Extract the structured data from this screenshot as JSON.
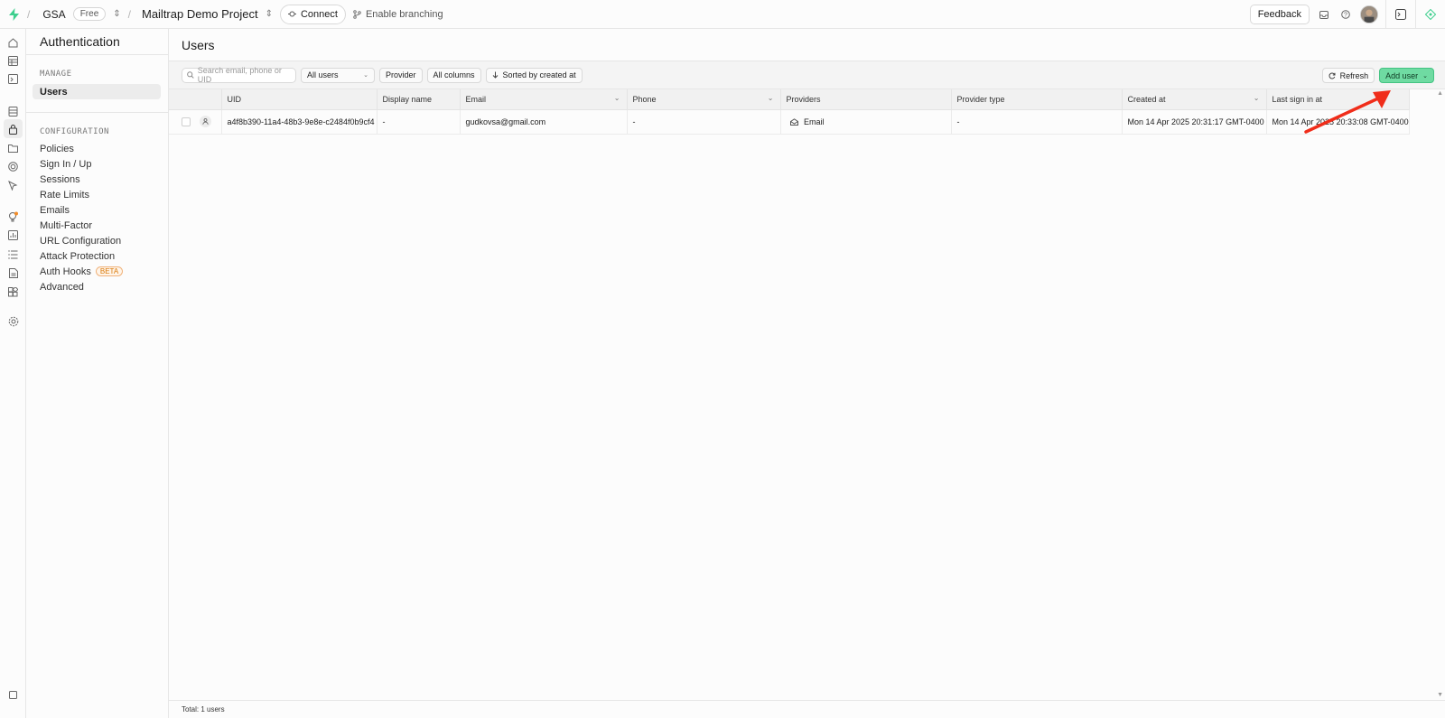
{
  "topbar": {
    "org": "GSA",
    "plan": "Free",
    "project": "Mailtrap Demo Project",
    "connect": "Connect",
    "branching": "Enable branching",
    "feedback": "Feedback"
  },
  "sidenav": {
    "title": "Authentication",
    "manage_label": "MANAGE",
    "manage_items": [
      "Users"
    ],
    "config_label": "CONFIGURATION",
    "config_items": [
      "Policies",
      "Sign In / Up",
      "Sessions",
      "Rate Limits",
      "Emails",
      "Multi-Factor",
      "URL Configuration",
      "Attack Protection",
      "Auth Hooks",
      "Advanced"
    ],
    "beta_badge": "BETA"
  },
  "main": {
    "title": "Users",
    "search_placeholder": "Search email, phone or UID",
    "filter_users": "All users",
    "provider": "Provider",
    "all_columns": "All columns",
    "sorted": "Sorted by created at",
    "refresh": "Refresh",
    "add_user": "Add user",
    "footer": "Total: 1 users"
  },
  "table": {
    "columns": [
      "UID",
      "Display name",
      "Email",
      "Phone",
      "Providers",
      "Provider type",
      "Created at",
      "Last sign in at"
    ],
    "rows": [
      {
        "uid": "a4f8b390-11a4-48b3-9e8e-c2484f0b9cf4",
        "display_name": "-",
        "email": "gudkovsa@gmail.com",
        "phone": "-",
        "providers": "Email",
        "provider_type": "-",
        "created_at": "Mon 14 Apr 2025 20:31:17 GMT-0400",
        "last_sign_in": "Mon 14 Apr 2025 20:33:08 GMT-0400"
      }
    ]
  },
  "colors": {
    "accent": "#6fdba2",
    "annotation_arrow": "#f02d1a"
  }
}
